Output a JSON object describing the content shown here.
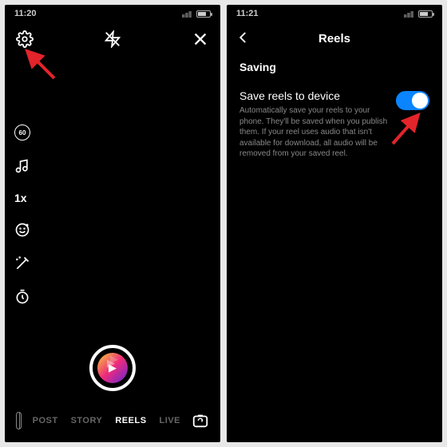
{
  "left": {
    "time": "11:20",
    "modes": {
      "post": "POST",
      "story": "STORY",
      "reels": "REELS",
      "live": "LIVE"
    },
    "speed": "1x",
    "duration": "60"
  },
  "right": {
    "time": "11:21",
    "title": "Reels",
    "section": "Saving",
    "setting_title": "Save reels to device",
    "setting_desc": "Automatically save your reels to your phone. They'll be saved when you publish them. If your reel uses audio that isn't available for download, all audio will be removed from your saved reel."
  }
}
